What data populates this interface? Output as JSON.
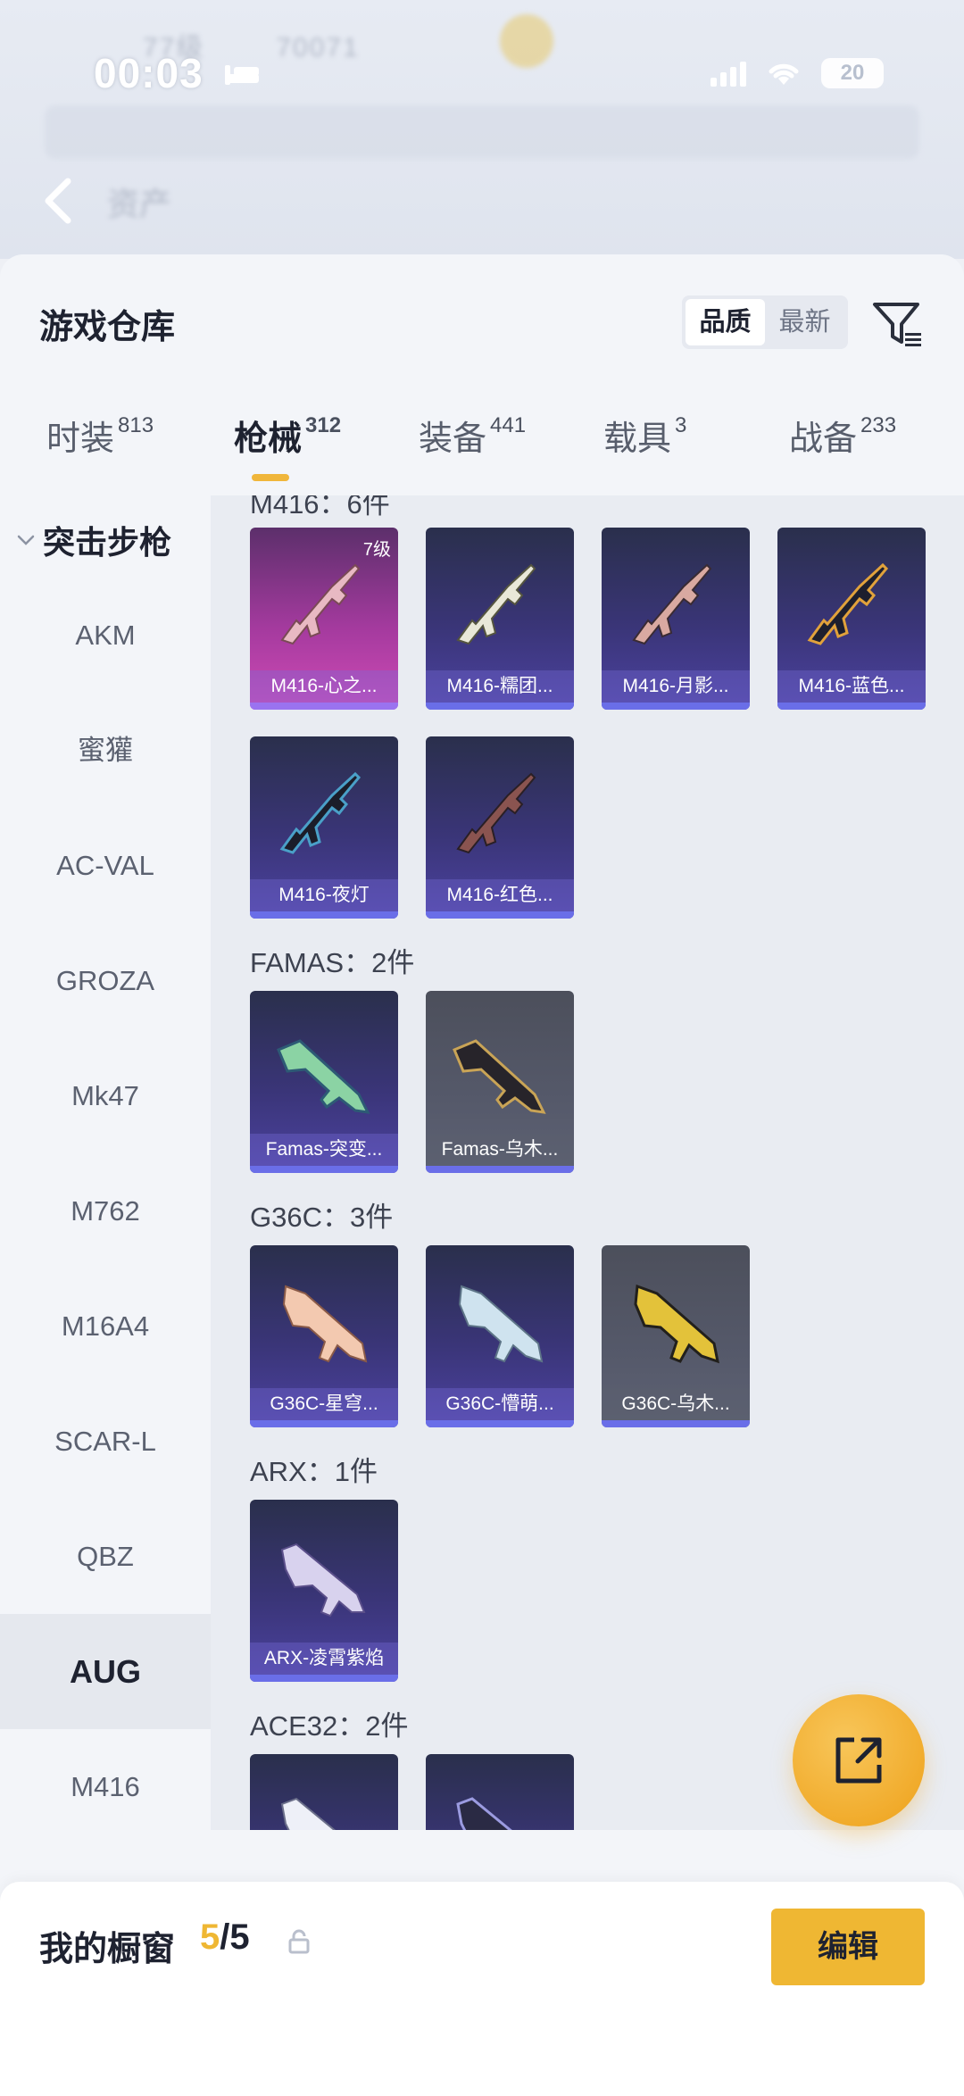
{
  "status_bar": {
    "time": "00:03",
    "battery": "20"
  },
  "sheet": {
    "title": "游戏仓库",
    "sort_options": [
      {
        "label": "品质",
        "active": true
      },
      {
        "label": "最新",
        "active": false
      }
    ]
  },
  "tabs": [
    {
      "label": "时装",
      "count": "813",
      "active": false
    },
    {
      "label": "枪械",
      "count": "312",
      "active": true
    },
    {
      "label": "装备",
      "count": "441",
      "active": false
    },
    {
      "label": "载具",
      "count": "3",
      "active": false
    },
    {
      "label": "战备",
      "count": "233",
      "active": false
    }
  ],
  "sidebar": {
    "group_label": "突击步枪",
    "items": [
      {
        "label": "AKM",
        "active": false
      },
      {
        "label": "蜜獾",
        "active": false
      },
      {
        "label": "AC-VAL",
        "active": false
      },
      {
        "label": "GROZA",
        "active": false
      },
      {
        "label": "Mk47",
        "active": false
      },
      {
        "label": "M762",
        "active": false
      },
      {
        "label": "M16A4",
        "active": false
      },
      {
        "label": "SCAR-L",
        "active": false
      },
      {
        "label": "QBZ",
        "active": false
      },
      {
        "label": "AUG",
        "active": true
      },
      {
        "label": "M416",
        "active": false
      }
    ]
  },
  "content": {
    "categories": [
      {
        "label": "M416：6件",
        "items": [
          {
            "name": "M416-心之...",
            "rarity": "pink",
            "level": "7级"
          },
          {
            "name": "M416-糯团...",
            "rarity": "purple"
          },
          {
            "name": "M416-月影...",
            "rarity": "purple"
          },
          {
            "name": "M416-蓝色...",
            "rarity": "purple"
          },
          {
            "name": "M416-夜灯",
            "rarity": "purple"
          },
          {
            "name": "M416-红色...",
            "rarity": "purple"
          }
        ]
      },
      {
        "label": "FAMAS：2件",
        "items": [
          {
            "name": "Famas-突变...",
            "rarity": "purple"
          },
          {
            "name": "Famas-乌木...",
            "rarity": "gray"
          }
        ]
      },
      {
        "label": "G36C：3件",
        "items": [
          {
            "name": "G36C-星穹...",
            "rarity": "purple"
          },
          {
            "name": "G36C-懵萌...",
            "rarity": "purple"
          },
          {
            "name": "G36C-乌木...",
            "rarity": "gray"
          }
        ]
      },
      {
        "label": "ARX：1件",
        "items": [
          {
            "name": "ARX-凌霄紫焰",
            "rarity": "purple"
          }
        ]
      },
      {
        "label": "ACE32：2件",
        "items": [
          {
            "name": "",
            "rarity": "purple"
          },
          {
            "name": "",
            "rarity": "purple"
          }
        ]
      }
    ]
  },
  "showcase": {
    "label": "我的橱窗",
    "current": "5",
    "separator": "/",
    "max": "5",
    "edit_label": "编辑"
  }
}
